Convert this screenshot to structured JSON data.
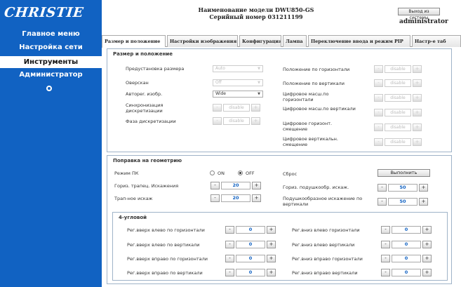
{
  "sidebar": {
    "logo": "CHRISTIE",
    "items": [
      "Главное меню",
      "Настройка сети",
      "Инструменты",
      "Администратор"
    ],
    "active_item": "Инструменты",
    "bottom_icon": "gear-icon"
  },
  "header": {
    "model_line": "Наименование модели DWU850-GS",
    "serial_line": "Серийный номер 031211199",
    "logout": "Выход из системы",
    "user": "administrator"
  },
  "tabs": [
    "Размер и положение",
    "Настройки изображения",
    "Конфигурация",
    "Лампа",
    "Переключение ввода и режим PIP",
    "Настр-е таб"
  ],
  "size_position": {
    "title": "Размер и положение",
    "preset_label": "Предустановка размера",
    "preset_value": "Auto",
    "overscan_label": "Оверскан",
    "overscan_value": "Off",
    "auto_label": "Автореr. изобр.",
    "auto_value": "Wide",
    "sync_label": "Синхронизация дискретизации",
    "phase_label": "Фаза дискретизации",
    "hpos_label": "Положение по горизонтали",
    "vpos_label": "Положение по вертикали",
    "dig_h_label": "Цифровое масш.по горизонтали",
    "dig_v_label": "Цифровое масш.по вертикали",
    "dig_hshift_label": "Цифровое горизонт. смещение",
    "dig_vshift_label": "Цифровое вертикальн. смещение",
    "disabled_text": "disable",
    "minus": "-",
    "plus": "+"
  },
  "geometry": {
    "title": "Поправка на геометрию",
    "pc_mode_label": "Режим ПК",
    "on": "ON",
    "off": "OFF",
    "reset_label": "Сброс",
    "execute": "Выполнить",
    "h_keystone_label": "Гориз. трапец. Искажения",
    "h_keystone_value": "20",
    "trap_label": "Трап-ное искаж",
    "trap_value": "20",
    "h_pillow_label": "Гориз. подушкообр. искаж.",
    "h_pillow_value": "50",
    "pillow_v_label": "Подушкообразное искажение по вертикали",
    "pillow_v_value": "50"
  },
  "corner": {
    "title": "4-угловой",
    "left": [
      {
        "label": "Рег.вверх влево по горизонтали",
        "value": "0"
      },
      {
        "label": "Рег.вверх влево по вертикали",
        "value": "0"
      },
      {
        "label": "Рег.вверх вправо по горизонтали",
        "value": "0"
      },
      {
        "label": "Рег.вверх вправо по вертикали",
        "value": "0"
      }
    ],
    "right": [
      {
        "label": "Рег.вниз влево горизонтали",
        "value": "0"
      },
      {
        "label": "Рег.вниз влево вертикали",
        "value": "0"
      },
      {
        "label": "Рег.вниз вправо горизонтали",
        "value": "0"
      },
      {
        "label": "Рег.вниз вправо вертикали",
        "value": "0"
      }
    ]
  }
}
